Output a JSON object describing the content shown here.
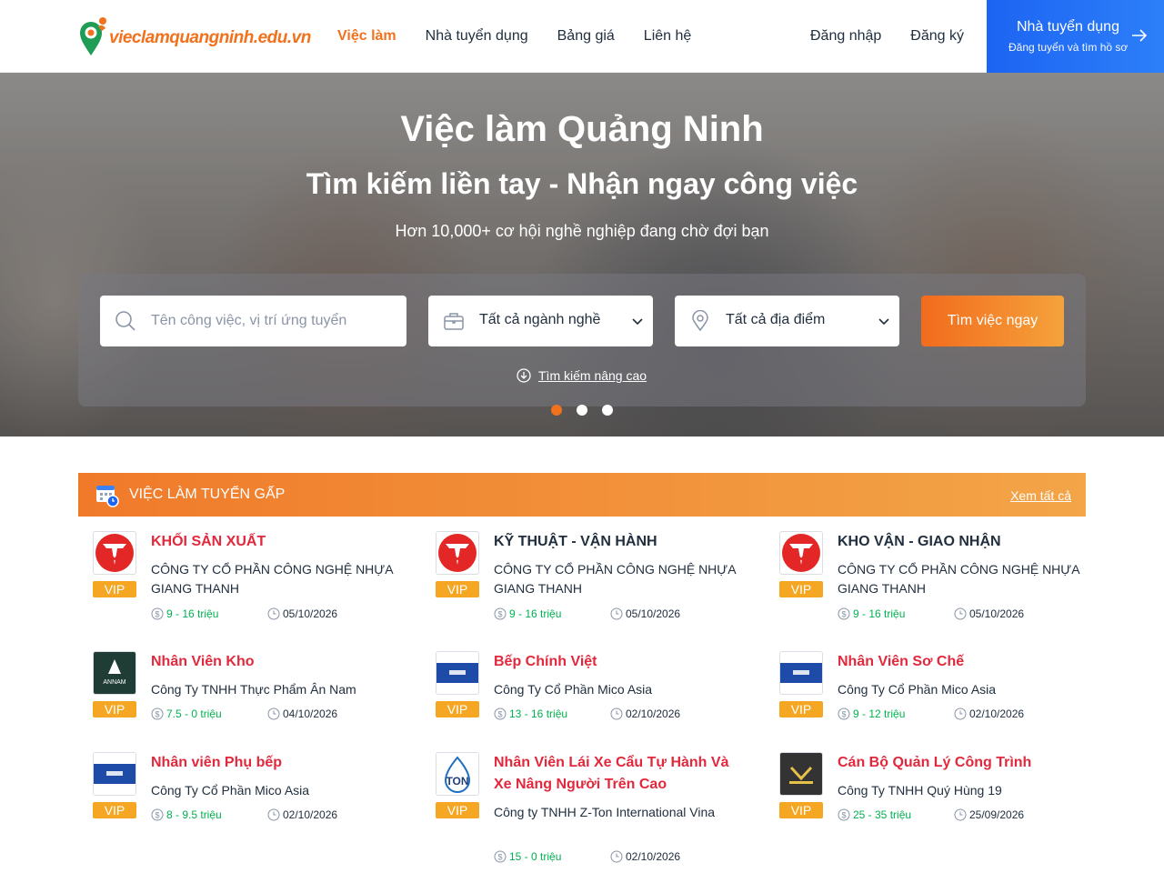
{
  "header": {
    "logo_text": "vieclamquangninh.edu.vn",
    "nav": [
      "Việc làm",
      "Nhà tuyển dụng",
      "Bảng giá",
      "Liên hệ"
    ],
    "login": "Đăng nhập",
    "register": "Đăng ký",
    "employer_title": "Nhà tuyển dụng",
    "employer_subtitle": "Đăng tuyển và tìm hồ sơ"
  },
  "hero": {
    "title": "Việc làm Quảng Ninh",
    "subtitle": "Tìm kiếm liền tay - Nhận ngay công việc",
    "tagline": "Hơn 10,000+ cơ hội nghề nghiệp đang chờ đợi bạn",
    "search_placeholder": "Tên công việc, vị trí ứng tuyển",
    "industry_select": "Tất cả ngành nghề",
    "location_select": "Tất cả địa điểm",
    "search_button": "Tìm việc ngay",
    "advanced_link": "Tìm kiếm nâng cao"
  },
  "urgent": {
    "title": "VIỆC LÀM TUYỂN GẤP",
    "see_all": "Xem tất cả",
    "vip_label": "VIP",
    "jobs": [
      {
        "title": "KHỐI SẢN XUẤT",
        "company": "CÔNG TY CỔ PHẦN CÔNG NGHỆ NHỰA GIANG THANH",
        "salary": "9 - 16 triệu",
        "date": "05/10/2026",
        "logo": "giang-thanh",
        "title_color": "red"
      },
      {
        "title": "KỸ THUẬT - VẬN HÀNH",
        "company": "CÔNG TY CỔ PHẦN CÔNG NGHỆ NHỰA GIANG THANH",
        "salary": "9 - 16 triệu",
        "date": "05/10/2026",
        "logo": "giang-thanh",
        "title_color": "dark"
      },
      {
        "title": "KHO VẬN - GIAO NHẬN",
        "company": "CÔNG TY CỔ PHẦN CÔNG NGHỆ NHỰA GIANG THANH",
        "salary": "9 - 16 triệu",
        "date": "05/10/2026",
        "logo": "giang-thanh",
        "title_color": "dark"
      },
      {
        "title": "Nhân Viên Kho",
        "company": "Công Ty TNHH Thực Phẩm Ân Nam",
        "salary": "7.5 - 0 triệu",
        "date": "04/10/2026",
        "logo": "annam",
        "title_color": "red"
      },
      {
        "title": "Bếp Chính Việt",
        "company": "Công Ty Cổ Phần Mico Asia",
        "salary": "13 - 16 triệu",
        "date": "02/10/2026",
        "logo": "mico",
        "title_color": "red"
      },
      {
        "title": "Nhân Viên Sơ Chế",
        "company": "Công Ty Cổ Phần Mico Asia",
        "salary": "9 - 12 triệu",
        "date": "02/10/2026",
        "logo": "mico",
        "title_color": "red"
      },
      {
        "title": "Nhân viên Phụ bếp",
        "company": "Công Ty Cổ Phần Mico Asia",
        "salary": "8 - 9.5 triệu",
        "date": "02/10/2026",
        "logo": "mico",
        "title_color": "red"
      },
      {
        "title": "Nhân Viên Lái Xe Cẩu Tự Hành Và Xe Nâng Người Trên Cao",
        "company": "Công ty TNHH Z-Ton International Vina",
        "salary": "15 - 0 triệu",
        "date": "02/10/2026",
        "logo": "zton",
        "title_color": "red"
      },
      {
        "title": "Cán Bộ Quản Lý Công Trình",
        "company": "Công Ty TNHH Quý Hùng 19",
        "salary": "25 - 35 triệu",
        "date": "25/09/2026",
        "logo": "quyhung",
        "title_color": "red"
      }
    ]
  },
  "colors": {
    "accent": "#f2711c",
    "primary_blue": "#1c64f2",
    "job_title_red": "#e1283c",
    "salary_green": "#00b14f",
    "vip_badge": "#f5a623"
  }
}
